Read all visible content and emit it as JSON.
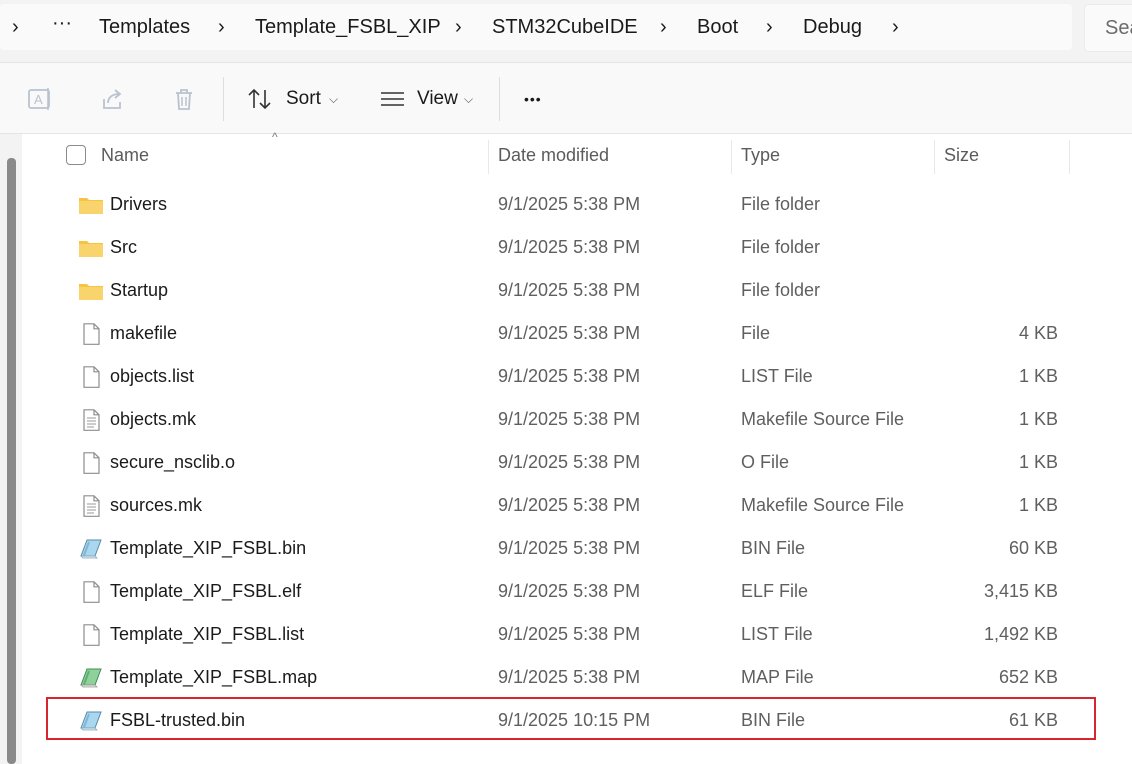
{
  "breadcrumb": {
    "overflow": "···",
    "items": [
      "Templates",
      "Template_FSBL_XIP",
      "STM32CubeIDE",
      "Boot",
      "Debug"
    ]
  },
  "search": {
    "placeholder": "Sea"
  },
  "toolbar": {
    "sort_label": "Sort",
    "view_label": "View",
    "more_label": "•••"
  },
  "columns": {
    "name": "Name",
    "date": "Date modified",
    "type": "Type",
    "size": "Size"
  },
  "files": [
    {
      "name": "Drivers",
      "date": "9/1/2025 5:38 PM",
      "type": "File folder",
      "size": "",
      "icon": "folder-icon"
    },
    {
      "name": "Src",
      "date": "9/1/2025 5:38 PM",
      "type": "File folder",
      "size": "",
      "icon": "folder-icon"
    },
    {
      "name": "Startup",
      "date": "9/1/2025 5:38 PM",
      "type": "File folder",
      "size": "",
      "icon": "folder-icon"
    },
    {
      "name": "makefile",
      "date": "9/1/2025 5:38 PM",
      "type": "File",
      "size": "4 KB",
      "icon": "file-icon"
    },
    {
      "name": "objects.list",
      "date": "9/1/2025 5:38 PM",
      "type": "LIST File",
      "size": "1 KB",
      "icon": "file-icon"
    },
    {
      "name": "objects.mk",
      "date": "9/1/2025 5:38 PM",
      "type": "Makefile Source File",
      "size": "1 KB",
      "icon": "text-file-icon"
    },
    {
      "name": "secure_nsclib.o",
      "date": "9/1/2025 5:38 PM",
      "type": "O File",
      "size": "1 KB",
      "icon": "file-icon"
    },
    {
      "name": "sources.mk",
      "date": "9/1/2025 5:38 PM",
      "type": "Makefile Source File",
      "size": "1 KB",
      "icon": "text-file-icon"
    },
    {
      "name": "Template_XIP_FSBL.bin",
      "date": "9/1/2025 5:38 PM",
      "type": "BIN File",
      "size": "60 KB",
      "icon": "bin-file-icon"
    },
    {
      "name": "Template_XIP_FSBL.elf",
      "date": "9/1/2025 5:38 PM",
      "type": "ELF File",
      "size": "3,415 KB",
      "icon": "file-icon"
    },
    {
      "name": "Template_XIP_FSBL.list",
      "date": "9/1/2025 5:38 PM",
      "type": "LIST File",
      "size": "1,492 KB",
      "icon": "file-icon"
    },
    {
      "name": "Template_XIP_FSBL.map",
      "date": "9/1/2025 5:38 PM",
      "type": "MAP File",
      "size": "652 KB",
      "icon": "map-file-icon"
    },
    {
      "name": "FSBL-trusted.bin",
      "date": "9/1/2025 10:15 PM",
      "type": "BIN File",
      "size": "61 KB",
      "icon": "bin-file-icon"
    }
  ],
  "colors": {
    "highlight": "#d6252c",
    "folder": "#f6c443"
  }
}
